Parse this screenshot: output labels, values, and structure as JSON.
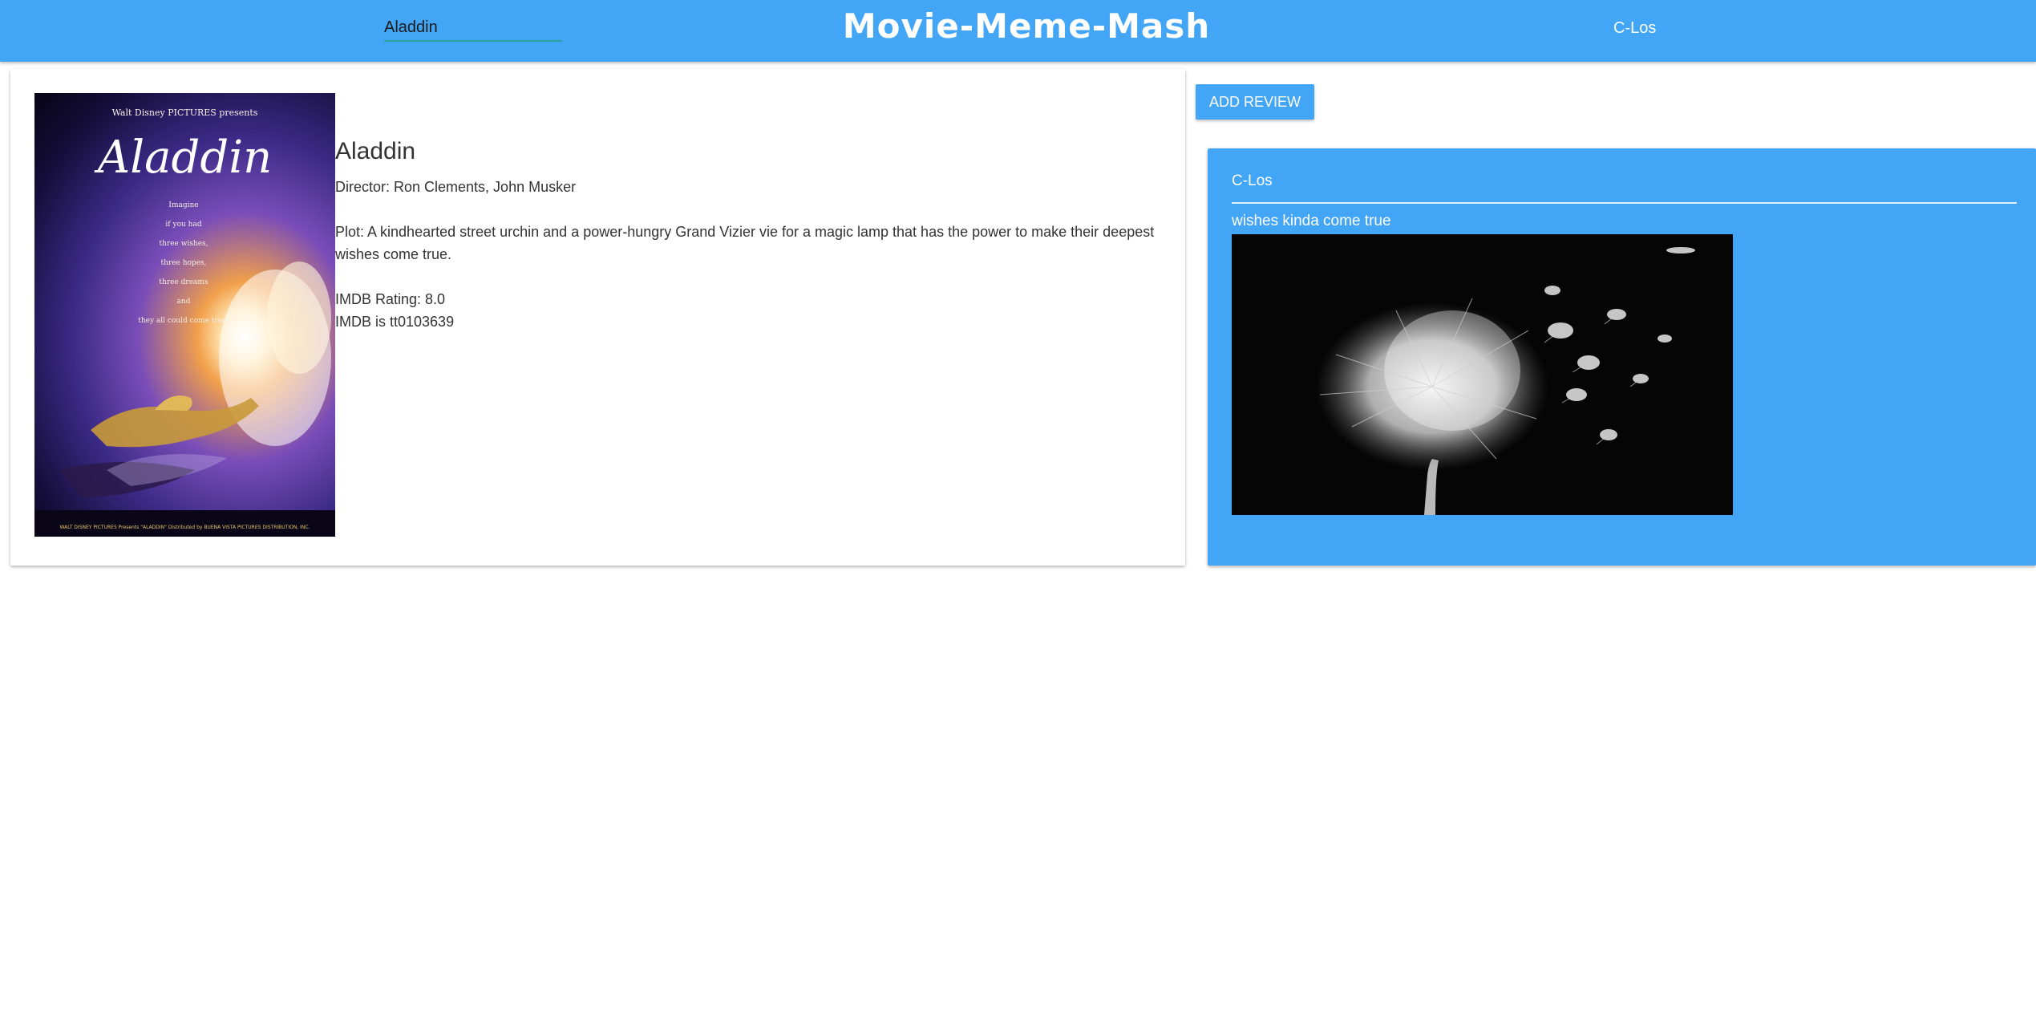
{
  "header": {
    "search_value": "Aladdin",
    "app_title": "Movie-Meme-Mash",
    "user_name": "C-Los",
    "background_color": "#42a5f5"
  },
  "movie": {
    "title": "Aladdin",
    "director": "Director: Ron Clements, John Musker",
    "plot": "Plot: A kindhearted street urchin and a power-hungry Grand Vizier vie for a magic lamp that has the power to make their deepest wishes come true.",
    "rating": "IMDB Rating: 8.0",
    "imdb_id": "IMDB is tt0103639",
    "poster": {
      "studio": "Walt Disney PICTURES presents",
      "title": "Aladdin",
      "tagline": "Imagine\nif you had\nthree wishes,\nthree hopes,\nthree dreams\nand\nthey all could come true.",
      "credits": "WALT DISNEY PICTURES Presents \"ALADDIN\" Distributed by BUENA VISTA PICTURES DISTRIBUTION, INC."
    }
  },
  "actions": {
    "add_review_label": "ADD REVIEW"
  },
  "reviews": [
    {
      "author": "C-Los",
      "text": "wishes kinda come true",
      "image": "dandelion-seeds-blowing"
    }
  ]
}
